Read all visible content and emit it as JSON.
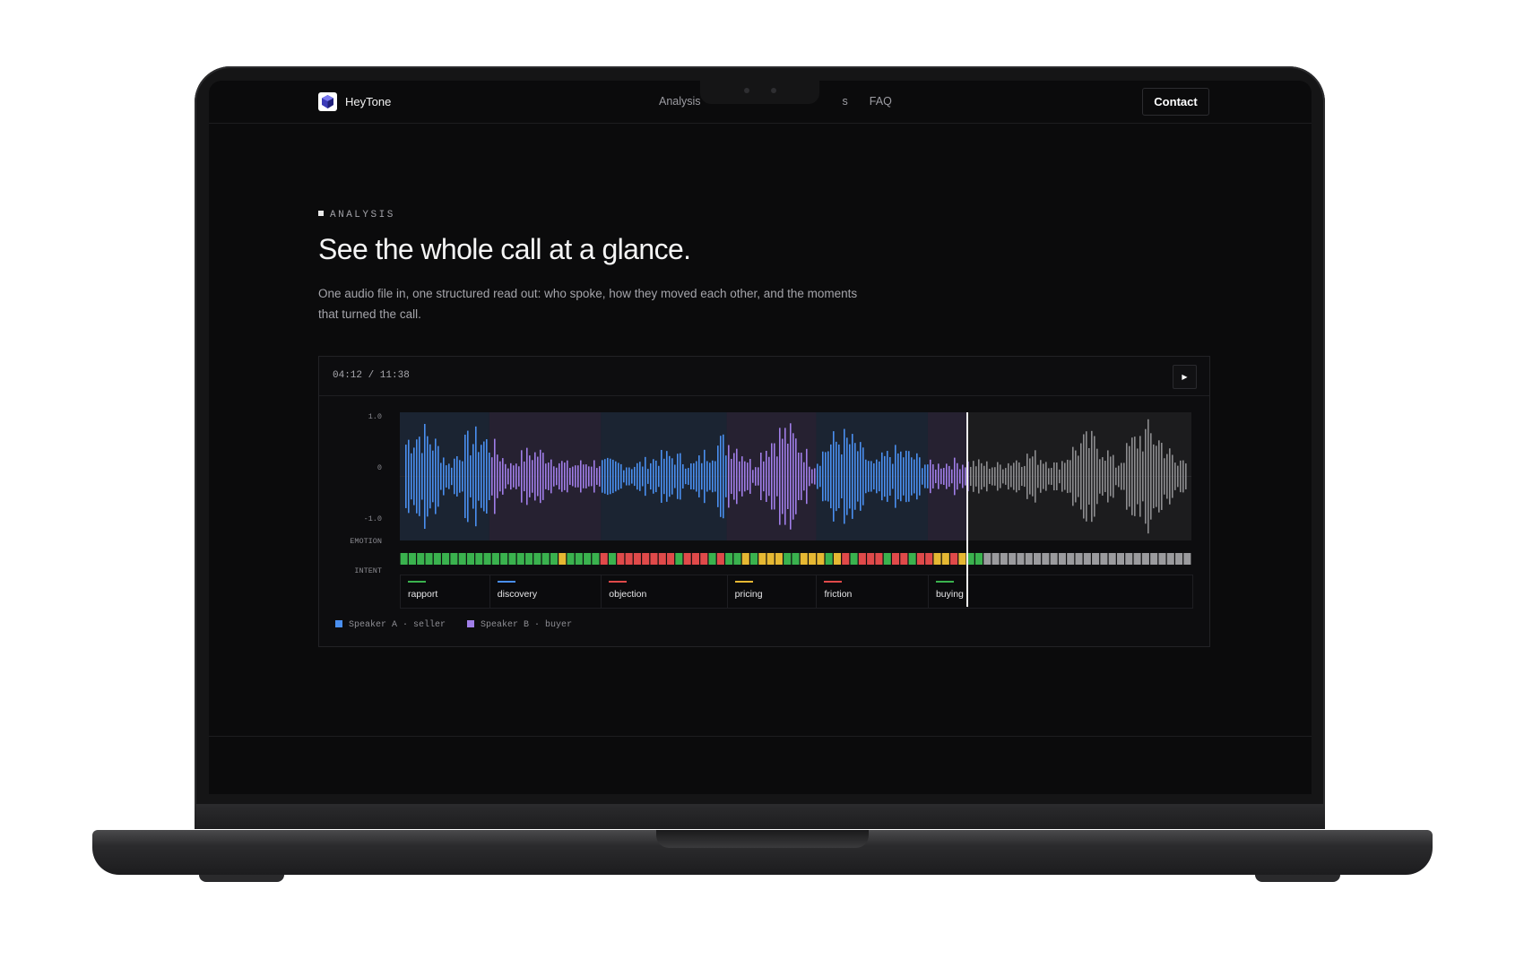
{
  "nav": {
    "brand": "HeyTone",
    "links": [
      "Analysis",
      "",
      "s",
      "FAQ"
    ],
    "contact_label": "Contact"
  },
  "hero": {
    "eyebrow": "ANALYSIS",
    "title": "See the whole call at a glance.",
    "subtitle": "One audio file in, one structured read out: who spoke, how they moved each other, and the moments that turned the call."
  },
  "player": {
    "time": "04:12 / 11:38",
    "play_icon": "play-icon",
    "progress": 0.717
  },
  "chart_data": {
    "type": "area",
    "y_ticks": [
      "1.0",
      "0",
      "-1.0"
    ],
    "ylim": [
      -1.0,
      1.0
    ],
    "row_labels": {
      "emotion": "EMOTION",
      "intent": "INTENT"
    },
    "segments": [
      {
        "speaker": "A",
        "start": 0.0,
        "end": 0.113,
        "intent": "rapport"
      },
      {
        "speaker": "B",
        "start": 0.113,
        "end": 0.254,
        "intent": "discovery"
      },
      {
        "speaker": "A",
        "start": 0.254,
        "end": 0.413,
        "intent": "objection"
      },
      {
        "speaker": "B",
        "start": 0.413,
        "end": 0.526,
        "intent": "pricing"
      },
      {
        "speaker": "A",
        "start": 0.526,
        "end": 0.667,
        "intent": "friction"
      },
      {
        "speaker": "B",
        "start": 0.667,
        "end": 0.717,
        "intent": "buying"
      }
    ],
    "emotion": "gggggggggggggggggggyggggrgrrrrrrrgrrrgrggygyyyggyyygyrgrrrgrrgrryyrygg",
    "emotion_count": 95,
    "speakers": [
      {
        "name": "Speaker A · seller",
        "color": "#4a8ff0"
      },
      {
        "name": "Speaker B · buyer",
        "color": "#a07ee8"
      }
    ],
    "colors": {
      "speaker_a": "#4a8ff0",
      "speaker_b": "#a07ee8",
      "unplayed": "#8d8d90",
      "emotion_positive": "#3ab24e",
      "emotion_neutral": "#e6b833",
      "emotion_negative": "#e04a4a",
      "emotion_unplayed": "#9b9b9e"
    },
    "intents": [
      {
        "label": "rapport",
        "color": "#3ab24e"
      },
      {
        "label": "discovery",
        "color": "#4a8ff0"
      },
      {
        "label": "objection",
        "color": "#e04a4a"
      },
      {
        "label": "pricing",
        "color": "#e6b833"
      },
      {
        "label": "friction",
        "color": "#e04a4a"
      },
      {
        "label": "buying",
        "color": "#3ab24e"
      }
    ]
  }
}
